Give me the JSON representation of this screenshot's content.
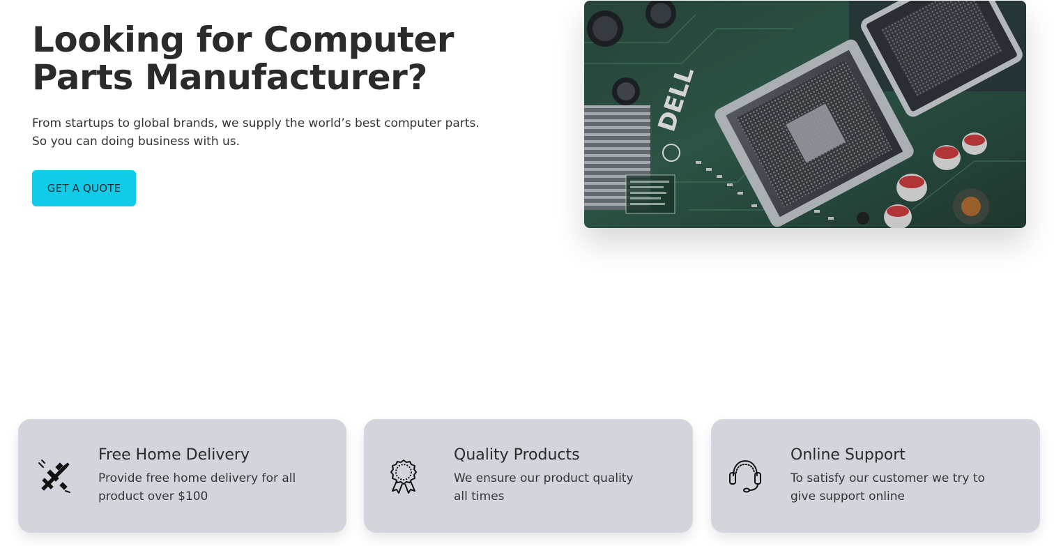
{
  "hero": {
    "title_line1": "Looking for Computer",
    "title_line2": "Parts Manufacturer?",
    "description_line1": "From startups to global brands, we supply the world’s best computer parts.",
    "description_line2": "So you can doing business with us.",
    "cta_label": "GET A QUOTE",
    "image_brand_text": "DELL"
  },
  "features": [
    {
      "icon": "delivery-plane-icon",
      "title": "Free Home Delivery",
      "desc_line1": "Provide free home delivery for all",
      "desc_line2": "product over $100"
    },
    {
      "icon": "award-ribbon-icon",
      "title": "Quality Products",
      "desc_line1": "We ensure our product quality",
      "desc_line2": "all times"
    },
    {
      "icon": "headset-icon",
      "title": "Online Support",
      "desc_line1": "To satisfy our customer we try to",
      "desc_line2": "give support online"
    }
  ],
  "colors": {
    "accent": "#12cbe8",
    "card_bg": "#d2d5dc",
    "heading": "#2b2b2b"
  }
}
